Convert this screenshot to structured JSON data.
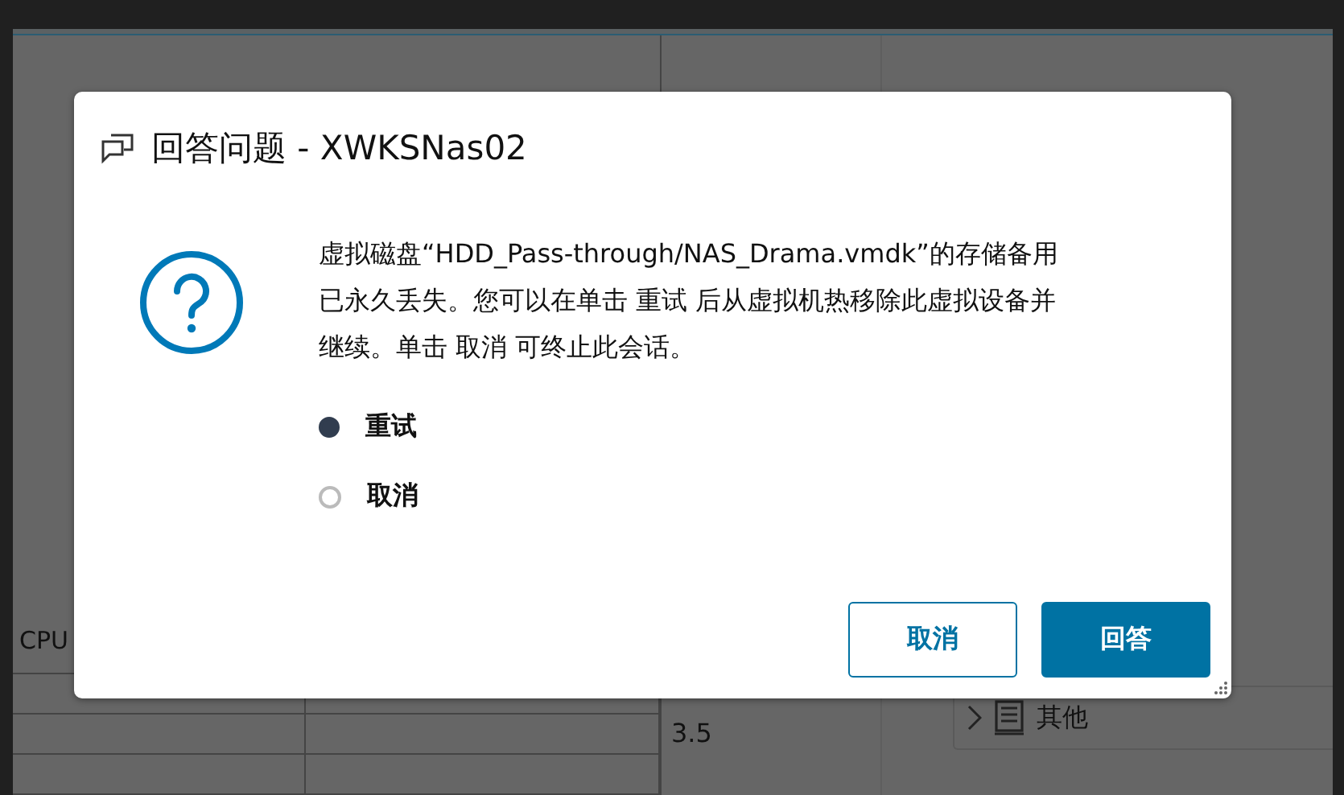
{
  "background": {
    "table_label": "CPU",
    "value": "3.5",
    "panel_item": {
      "label": "其他",
      "expanded": false
    }
  },
  "dialog": {
    "title": "回答问题 - XWKSNas02",
    "message": "虚拟磁盘“HDD_Pass-through/NAS_Drama.vmdk”的存储备用已永久丢失。您可以在单击 重试 后从虚拟机热移除此虚拟设备并继续。单击 取消 可终止此会话。",
    "options": [
      {
        "label": "重试",
        "selected": true
      },
      {
        "label": "取消",
        "selected": false
      }
    ],
    "buttons": [
      {
        "label": "取消",
        "kind": "secondary"
      },
      {
        "label": "回答",
        "kind": "primary"
      }
    ]
  }
}
